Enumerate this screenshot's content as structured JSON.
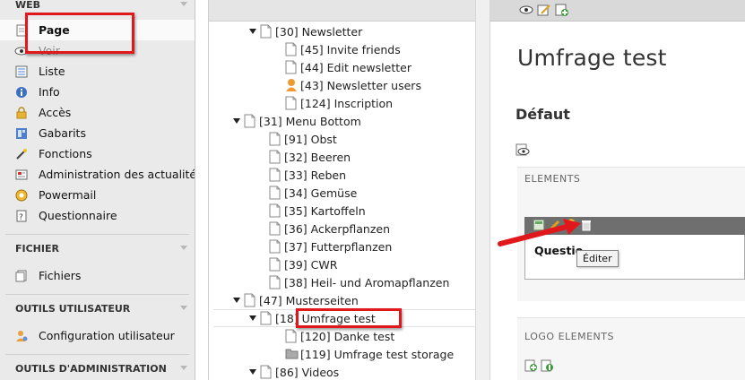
{
  "module_menu": {
    "web": {
      "title": "WEB",
      "items": [
        {
          "label": "Page",
          "icon": "page-icon"
        },
        {
          "label": "Voir",
          "icon": "view-icon"
        },
        {
          "label": "Liste",
          "icon": "list-icon"
        },
        {
          "label": "Info",
          "icon": "info-icon"
        },
        {
          "label": "Accès",
          "icon": "lock-icon"
        },
        {
          "label": "Gabarits",
          "icon": "template-icon"
        },
        {
          "label": "Fonctions",
          "icon": "wand-icon"
        },
        {
          "label": "Administration des actualités",
          "icon": "news-icon"
        },
        {
          "label": "Powermail",
          "icon": "powermail-icon"
        },
        {
          "label": "Questionnaire",
          "icon": "questionnaire-icon"
        }
      ]
    },
    "fichier": {
      "title": "FICHIER",
      "items": [
        {
          "label": "Fichiers",
          "icon": "files-icon"
        }
      ]
    },
    "outils_utilisateur": {
      "title": "OUTILS UTILISATEUR",
      "items": [
        {
          "label": "Configuration utilisateur",
          "icon": "user-settings-icon"
        }
      ]
    },
    "outils_admin": {
      "title": "OUTILS D'ADMINISTRATION"
    }
  },
  "tree": {
    "nodes": [
      {
        "label": "[30] Newsletter"
      },
      {
        "label": "[45] Invite friends"
      },
      {
        "label": "[44] Edit newsletter"
      },
      {
        "label": "[43] Newsletter users"
      },
      {
        "label": "[124] Inscription"
      },
      {
        "label": "[31] Menu Bottom"
      },
      {
        "label": "[91] Obst"
      },
      {
        "label": "[32] Beeren"
      },
      {
        "label": "[33] Reben"
      },
      {
        "label": "[34] Gemüse"
      },
      {
        "label": "[35] Kartoffeln"
      },
      {
        "label": "[36] Ackerpflanzen"
      },
      {
        "label": "[37] Futterpflanzen"
      },
      {
        "label": "[39] CWR"
      },
      {
        "label": "[38] Heil- und Aromapflanzen"
      },
      {
        "label": "[47] Musterseiten"
      },
      {
        "label": "[18] Umfrage test"
      },
      {
        "label": "[120] Danke test"
      },
      {
        "label": "[119] Umfrage test storage"
      },
      {
        "label": "[86] Videos"
      }
    ]
  },
  "content": {
    "page_title": "Umfrage test",
    "column_title": "Défaut",
    "elements_label": "ELEMENTS",
    "element_title": "Questio",
    "tooltip": "Éditer",
    "logo_elements_label": "LOGO ELEMENTS"
  },
  "colors": {
    "highlight": "#e0181b",
    "menu_bg": "#eaeaea"
  }
}
